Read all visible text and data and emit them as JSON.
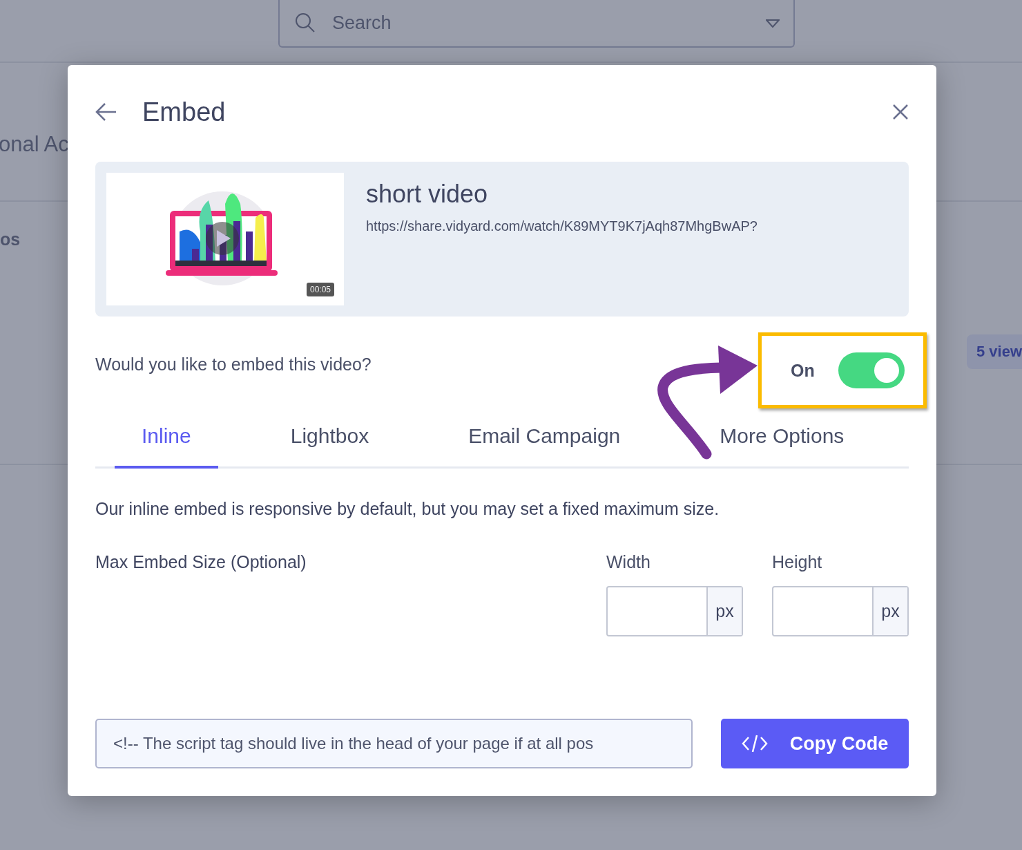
{
  "background": {
    "search": {
      "placeholder": "Search"
    },
    "heading_fragment": "onal Ac",
    "label_fragment": "os",
    "badge": "5 view"
  },
  "dialog": {
    "title": "Embed",
    "video": {
      "title": "short video",
      "url": "https://share.vidyard.com/watch/K89MYT9K7jAqh87MhgBwAP?",
      "duration": "00:05"
    },
    "embed_question": "Would you like to embed this video?",
    "embed_toggle": {
      "label": "On",
      "on": true
    },
    "tabs": [
      {
        "label": "Inline",
        "selected": true
      },
      {
        "label": "Lightbox",
        "selected": false
      },
      {
        "label": "Email Campaign",
        "selected": false
      },
      {
        "label": "More Options",
        "selected": false
      }
    ],
    "description": "Our inline embed is responsive by default, but you may set a fixed maximum size.",
    "max_size": {
      "label": "Max Embed Size (Optional)",
      "fields": [
        {
          "label": "Width",
          "unit": "px"
        },
        {
          "label": "Height",
          "unit": "px"
        }
      ]
    },
    "code_snippet": "<!-- The script tag should live in the head of your page if at all pos",
    "copy_button": "Copy Code"
  }
}
